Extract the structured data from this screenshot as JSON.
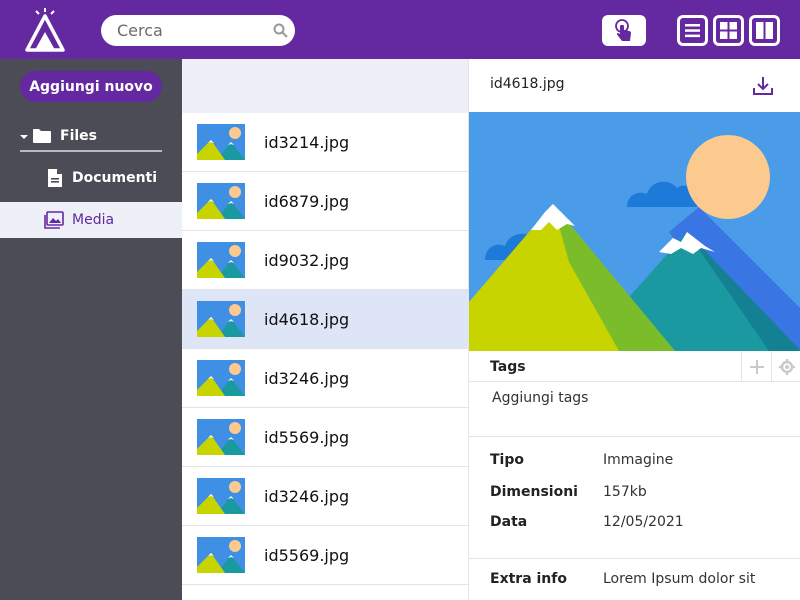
{
  "header": {
    "search_placeholder": "Cerca"
  },
  "sidebar": {
    "add_button": "Aggiungi nuovo",
    "tree": [
      {
        "label": "Files"
      },
      {
        "label": "Documenti"
      },
      {
        "label": "Media"
      }
    ]
  },
  "files": [
    {
      "name": "id3214.jpg"
    },
    {
      "name": "id6879.jpg"
    },
    {
      "name": "id9032.jpg"
    },
    {
      "name": "id4618.jpg",
      "selected": true
    },
    {
      "name": "id3246.jpg"
    },
    {
      "name": "id5569.jpg"
    },
    {
      "name": "id3246.jpg"
    },
    {
      "name": "id5569.jpg"
    }
  ],
  "details": {
    "title": "id4618.jpg",
    "tags_label": "Tags",
    "tags_placeholder": "Aggiungi tags",
    "props": [
      {
        "key": "Tipo",
        "value": "Immagine"
      },
      {
        "key": "Dimensioni",
        "value": "157kb"
      },
      {
        "key": "Data",
        "value": "12/05/2021"
      }
    ],
    "extra_key": "Extra info",
    "extra_value": "Lorem Ipsum dolor sit"
  },
  "colors": {
    "brand": "#6428a0",
    "sidebar": "#4b4c55",
    "selection": "#dde5f7",
    "panel_bg": "#eef0f8"
  },
  "icons": [
    "app-logo-icon",
    "search-icon",
    "touch-icon",
    "list-view-icon",
    "grid-view-icon",
    "columns-view-icon",
    "folder-icon",
    "document-icon",
    "image-icon",
    "download-icon",
    "plus-icon",
    "gear-icon",
    "caret-down-icon"
  ]
}
